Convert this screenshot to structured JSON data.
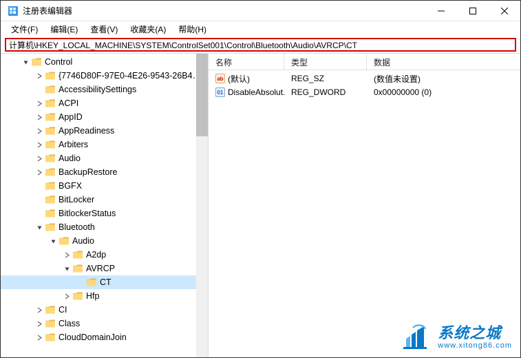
{
  "window": {
    "title": "注册表编辑器"
  },
  "menu": {
    "file": "文件(F)",
    "edit": "编辑(E)",
    "view": "查看(V)",
    "favorites": "收藏夹(A)",
    "help": "帮助(H)"
  },
  "address": "计算机\\HKEY_LOCAL_MACHINE\\SYSTEM\\ControlSet001\\Control\\Bluetooth\\Audio\\AVRCP\\CT",
  "tree": {
    "items": [
      {
        "label": "Control",
        "depth": 0,
        "expander": "open"
      },
      {
        "label": "{7746D80F-97E0-4E26-9543-26B4…",
        "depth": 1,
        "expander": "closed"
      },
      {
        "label": "AccessibilitySettings",
        "depth": 1,
        "expander": "none"
      },
      {
        "label": "ACPI",
        "depth": 1,
        "expander": "closed"
      },
      {
        "label": "AppID",
        "depth": 1,
        "expander": "closed"
      },
      {
        "label": "AppReadiness",
        "depth": 1,
        "expander": "closed"
      },
      {
        "label": "Arbiters",
        "depth": 1,
        "expander": "closed"
      },
      {
        "label": "Audio",
        "depth": 1,
        "expander": "closed"
      },
      {
        "label": "BackupRestore",
        "depth": 1,
        "expander": "closed"
      },
      {
        "label": "BGFX",
        "depth": 1,
        "expander": "none"
      },
      {
        "label": "BitLocker",
        "depth": 1,
        "expander": "none"
      },
      {
        "label": "BitlockerStatus",
        "depth": 1,
        "expander": "none"
      },
      {
        "label": "Bluetooth",
        "depth": 1,
        "expander": "open"
      },
      {
        "label": "Audio",
        "depth": 2,
        "expander": "open"
      },
      {
        "label": "A2dp",
        "depth": 3,
        "expander": "closed"
      },
      {
        "label": "AVRCP",
        "depth": 3,
        "expander": "open"
      },
      {
        "label": "CT",
        "depth": 4,
        "expander": "none",
        "selected": true
      },
      {
        "label": "Hfp",
        "depth": 3,
        "expander": "closed"
      },
      {
        "label": "CI",
        "depth": 1,
        "expander": "closed"
      },
      {
        "label": "Class",
        "depth": 1,
        "expander": "closed"
      },
      {
        "label": "CloudDomainJoin",
        "depth": 1,
        "expander": "closed"
      }
    ]
  },
  "list": {
    "headers": {
      "name": "名称",
      "type": "类型",
      "data": "数据"
    },
    "rows": [
      {
        "icon": "sz",
        "iconTxt": "ab",
        "name": "(默认)",
        "type": "REG_SZ",
        "data": "(数值未设置)"
      },
      {
        "icon": "dw",
        "iconTxt": "01",
        "name": "DisableAbsolut...",
        "type": "REG_DWORD",
        "data": "0x00000000 (0)"
      }
    ]
  },
  "watermark": {
    "main": "系统之城",
    "sub": "www.xitong86.com"
  }
}
